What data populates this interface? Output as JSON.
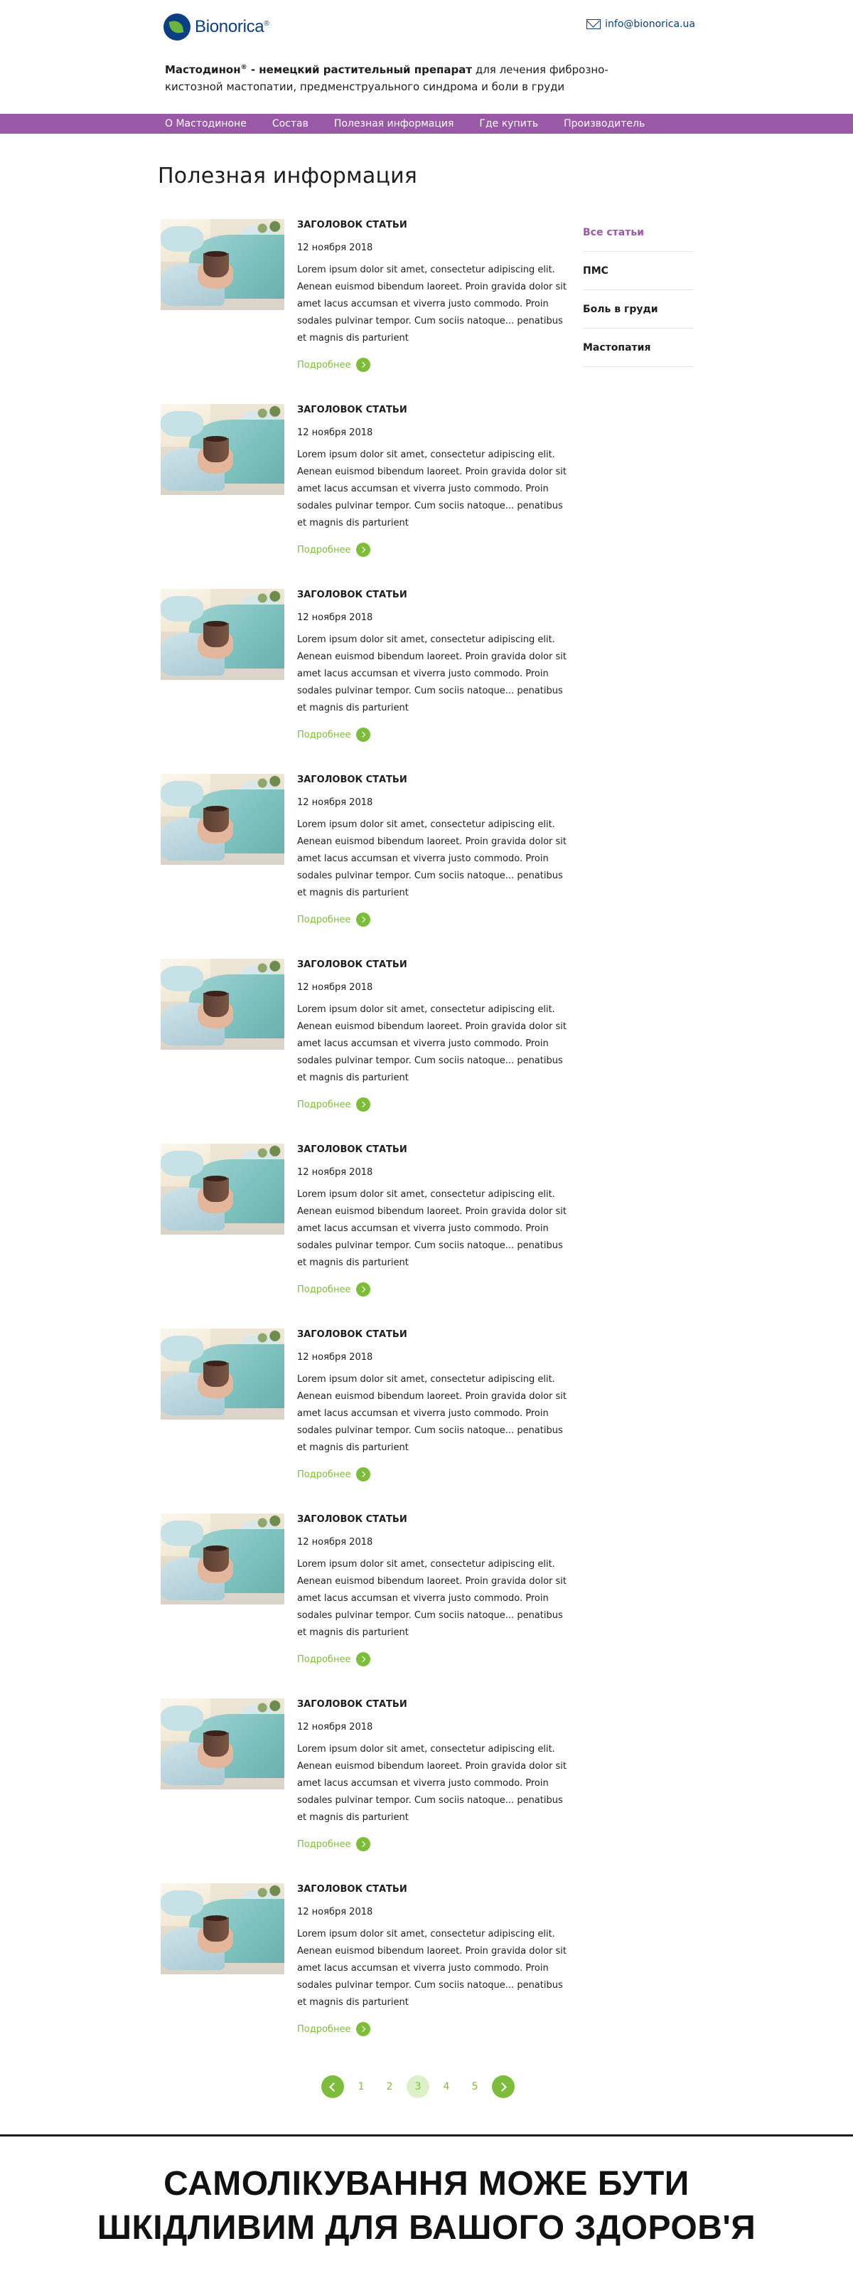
{
  "header": {
    "logo_text": "Bionorica",
    "logo_mark": "®",
    "email": "info@bionorica.ua",
    "tagline_brand": "Мастодинон",
    "tagline_reg": "®",
    "tagline_bold_rest": " - немецкий растительный препарат",
    "tagline_rest": " для лечения фиброзно-кистозной мастопатии, предменструального синдрома и боли в груди"
  },
  "nav": {
    "items": [
      "О Мастодиноне",
      "Состав",
      "Полезная информация",
      "Где купить",
      "Производитель"
    ]
  },
  "page_title": "Полезная информация",
  "articles": [
    {
      "title": "ЗАГОЛОВОК СТАТЬИ",
      "date": "12 ноября 2018",
      "text": "Lorem ipsum dolor sit amet, consectetur adipiscing elit. Aenean euismod bibendum laoreet. Proin gravida dolor sit amet lacus accumsan et viverra justo commodo. Proin sodales pulvinar tempor. Cum sociis natoque... penatibus et magnis dis parturient",
      "more": "Подробнее"
    },
    {
      "title": "ЗАГОЛОВОК СТАТЬИ",
      "date": "12 ноября 2018",
      "text": "Lorem ipsum dolor sit amet, consectetur adipiscing elit. Aenean euismod bibendum laoreet. Proin gravida dolor sit amet lacus accumsan et viverra justo commodo. Proin sodales pulvinar tempor. Cum sociis natoque... penatibus et magnis dis parturient",
      "more": "Подробнее"
    },
    {
      "title": "ЗАГОЛОВОК СТАТЬИ",
      "date": "12 ноября 2018",
      "text": "Lorem ipsum dolor sit amet, consectetur adipiscing elit. Aenean euismod bibendum laoreet. Proin gravida dolor sit amet lacus accumsan et viverra justo commodo. Proin sodales pulvinar tempor. Cum sociis natoque... penatibus et magnis dis parturient",
      "more": "Подробнее"
    },
    {
      "title": "ЗАГОЛОВОК СТАТЬИ",
      "date": "12 ноября 2018",
      "text": "Lorem ipsum dolor sit amet, consectetur adipiscing elit. Aenean euismod bibendum laoreet. Proin gravida dolor sit amet lacus accumsan et viverra justo commodo. Proin sodales pulvinar tempor. Cum sociis natoque... penatibus et magnis dis parturient",
      "more": "Подробнее"
    },
    {
      "title": "ЗАГОЛОВОК СТАТЬИ",
      "date": "12 ноября 2018",
      "text": "Lorem ipsum dolor sit amet, consectetur adipiscing elit. Aenean euismod bibendum laoreet. Proin gravida dolor sit amet lacus accumsan et viverra justo commodo. Proin sodales pulvinar tempor. Cum sociis natoque... penatibus et magnis dis parturient",
      "more": "Подробнее"
    },
    {
      "title": "ЗАГОЛОВОК СТАТЬИ",
      "date": "12 ноября 2018",
      "text": "Lorem ipsum dolor sit amet, consectetur adipiscing elit. Aenean euismod bibendum laoreet. Proin gravida dolor sit amet lacus accumsan et viverra justo commodo. Proin sodales pulvinar tempor. Cum sociis natoque... penatibus et magnis dis parturient",
      "more": "Подробнее"
    },
    {
      "title": "ЗАГОЛОВОК СТАТЬИ",
      "date": "12 ноября 2018",
      "text": "Lorem ipsum dolor sit amet, consectetur adipiscing elit. Aenean euismod bibendum laoreet. Proin gravida dolor sit amet lacus accumsan et viverra justo commodo. Proin sodales pulvinar tempor. Cum sociis natoque... penatibus et magnis dis parturient",
      "more": "Подробнее"
    },
    {
      "title": "ЗАГОЛОВОК СТАТЬИ",
      "date": "12 ноября 2018",
      "text": "Lorem ipsum dolor sit amet, consectetur adipiscing elit. Aenean euismod bibendum laoreet. Proin gravida dolor sit amet lacus accumsan et viverra justo commodo. Proin sodales pulvinar tempor. Cum sociis natoque... penatibus et magnis dis parturient",
      "more": "Подробнее"
    },
    {
      "title": "ЗАГОЛОВОК СТАТЬИ",
      "date": "12 ноября 2018",
      "text": "Lorem ipsum dolor sit amet, consectetur adipiscing elit. Aenean euismod bibendum laoreet. Proin gravida dolor sit amet lacus accumsan et viverra justo commodo. Proin sodales pulvinar tempor. Cum sociis natoque... penatibus et magnis dis parturient",
      "more": "Подробнее"
    },
    {
      "title": "ЗАГОЛОВОК СТАТЬИ",
      "date": "12 ноября 2018",
      "text": "Lorem ipsum dolor sit amet, consectetur adipiscing elit. Aenean euismod bibendum laoreet. Proin gravida dolor sit amet lacus accumsan et viverra justo commodo. Proin sodales pulvinar tempor. Cum sociis natoque... penatibus et magnis dis parturient",
      "more": "Подробнее"
    }
  ],
  "sidebar": {
    "items": [
      "Все статьи",
      "ПМС",
      "Боль в груди",
      "Мастопатия"
    ],
    "active_index": 0
  },
  "pagination": {
    "pages": [
      "1",
      "2",
      "3",
      "4",
      "5"
    ],
    "current": "3",
    "prev_icon": "chevron-left-icon",
    "next_icon": "chevron-right-icon"
  },
  "warning": {
    "line1": "САМОЛІКУВАННЯ МОЖЕ БУТИ",
    "line2": "ШКІДЛИВИМ ДЛЯ ВАШОГО ЗДОРОВ'Я"
  },
  "colors": {
    "brand_purple": "#9a59a7",
    "accent_green": "#7ebd3b",
    "brand_blue": "#0a3f82"
  },
  "icons": {
    "logo": "bionorica-leaf-logo",
    "email": "envelope-icon",
    "more": "chevron-right-circle-icon"
  }
}
